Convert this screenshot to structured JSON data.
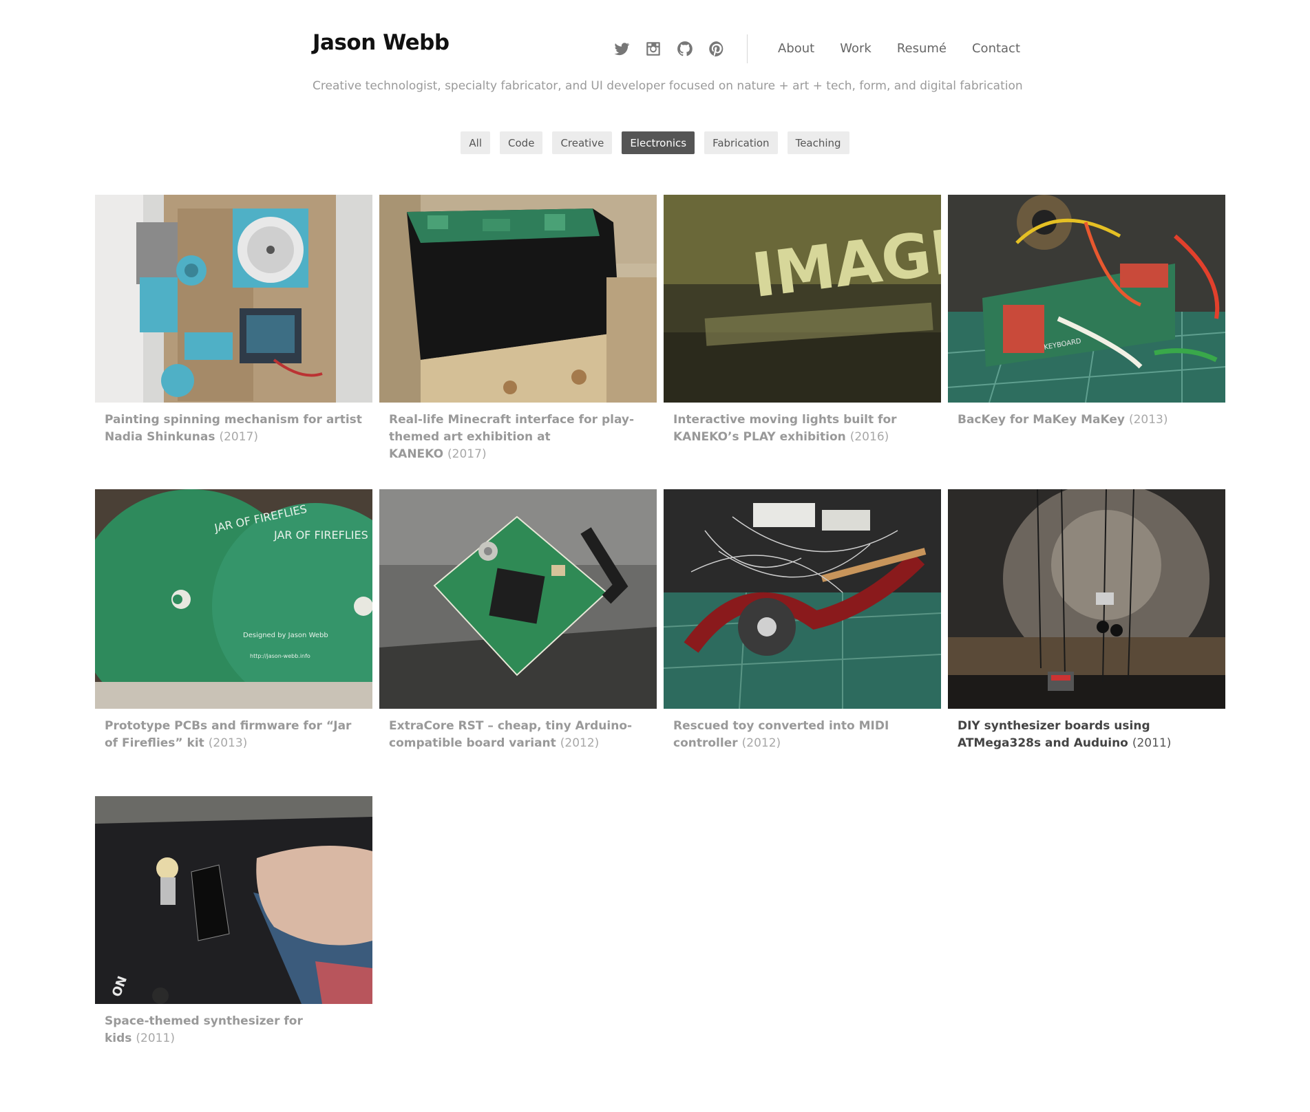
{
  "header": {
    "site_title": "Jason Webb",
    "tagline": "Creative technologist, specialty fabricator, and UI developer focused on nature + art + tech, form, and digital fabrication",
    "social": [
      "twitter-icon",
      "instagram-icon",
      "github-icon",
      "pinterest-icon"
    ],
    "nav": [
      "About",
      "Work",
      "Resumé",
      "Contact"
    ]
  },
  "filters": {
    "items": [
      "All",
      "Code",
      "Creative",
      "Electronics",
      "Fabrication",
      "Teaching"
    ],
    "active": "Electronics"
  },
  "projects": [
    {
      "title": "Painting spinning mechanism for artist Nadia Shinkunas",
      "year": "(2017)"
    },
    {
      "title": "Real-life Minecraft interface for play-themed art exhibition at KANEKO",
      "year": "(2017)"
    },
    {
      "title": "Interactive moving lights built for KANEKO’s PLAY exhibition",
      "year": "(2016)"
    },
    {
      "title": "BacKey for MaKey MaKey",
      "year": "(2013)"
    },
    {
      "title": "Prototype PCBs and firmware for “Jar of Fireflies” kit",
      "year": "(2013)"
    },
    {
      "title": "ExtraCore RST – cheap, tiny Arduino-compatible board variant",
      "year": "(2012)"
    },
    {
      "title": "Rescued toy converted into MIDI controller",
      "year": "(2012)"
    },
    {
      "title": "DIY synthesizer boards using ATMega328s and Auduino",
      "year": "(2011)"
    },
    {
      "title": "Space-themed synthesizer for kids",
      "year": "(2011)"
    }
  ],
  "image_text": {
    "p2": "IMAGIN",
    "p4": "KEYBOARD",
    "p5a": "JAR OF FIREFLIES",
    "p5b": "Designed by Jason Webb",
    "p5c": "http://jason-webb.info",
    "p9": "ON"
  },
  "colors": {
    "active_filter": "#555555",
    "caption": "#999999",
    "highlight_caption": "#444444"
  }
}
